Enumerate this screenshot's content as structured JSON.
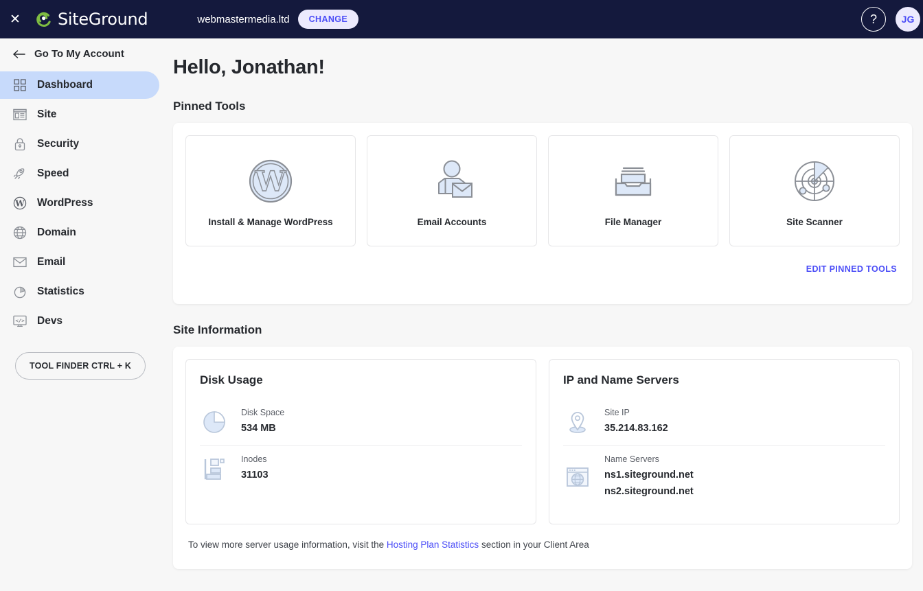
{
  "header": {
    "close_icon": "close-icon",
    "brand_name": "SiteGround",
    "site_domain": "webmastermedia.ltd",
    "change_label": "CHANGE",
    "help_icon": "question-mark-icon",
    "avatar_initials": "JG"
  },
  "sidebar": {
    "back_label": "Go To My Account",
    "back_icon": "arrow-left-icon",
    "items": [
      {
        "label": "Dashboard",
        "icon": "grid-icon",
        "active": true
      },
      {
        "label": "Site",
        "icon": "browser-icon",
        "active": false
      },
      {
        "label": "Security",
        "icon": "lock-icon",
        "active": false
      },
      {
        "label": "Speed",
        "icon": "rocket-icon",
        "active": false
      },
      {
        "label": "WordPress",
        "icon": "wordpress-icon",
        "active": false
      },
      {
        "label": "Domain",
        "icon": "globe-icon",
        "active": false
      },
      {
        "label": "Email",
        "icon": "envelope-icon",
        "active": false
      },
      {
        "label": "Statistics",
        "icon": "pie-chart-icon",
        "active": false
      },
      {
        "label": "Devs",
        "icon": "code-monitor-icon",
        "active": false
      }
    ],
    "tool_finder_label": "TOOL FINDER CTRL + K"
  },
  "main": {
    "greeting": "Hello, Jonathan!",
    "pinned_tools_title": "Pinned Tools",
    "tools": [
      {
        "label": "Install & Manage WordPress",
        "icon": "wordpress-logo-icon"
      },
      {
        "label": "Email Accounts",
        "icon": "user-envelope-icon"
      },
      {
        "label": "File Manager",
        "icon": "file-tray-icon"
      },
      {
        "label": "Site Scanner",
        "icon": "radar-icon"
      }
    ],
    "edit_pinned_label": "EDIT PINNED TOOLS",
    "site_information_title": "Site Information",
    "disk_panel": {
      "title": "Disk Usage",
      "rows": [
        {
          "label": "Disk Space",
          "value": "534 MB",
          "icon": "pie-chart-icon"
        },
        {
          "label": "Inodes",
          "value": "31103",
          "icon": "inodes-icon"
        }
      ]
    },
    "servers_panel": {
      "title": "IP and Name Servers",
      "rows": [
        {
          "label": "Site IP",
          "value": "35.214.83.162",
          "value2": "",
          "icon": "location-pin-icon"
        },
        {
          "label": "Name Servers",
          "value": "ns1.siteground.net",
          "value2": "ns2.siteground.net",
          "icon": "browser-globe-icon"
        }
      ]
    },
    "footnote_before": "To view more server usage information, visit the ",
    "footnote_link": "Hosting Plan Statistics",
    "footnote_after": " section in your Client Area"
  },
  "colors": {
    "header_bg": "#14193d",
    "accent_link": "#4b4df7",
    "active_nav_bg": "#c7dafb",
    "page_bg": "#f7f7f7",
    "icon_fill": "#dde8f8",
    "icon_stroke": "#8b8f96",
    "logo_green": "#7fbc42"
  }
}
